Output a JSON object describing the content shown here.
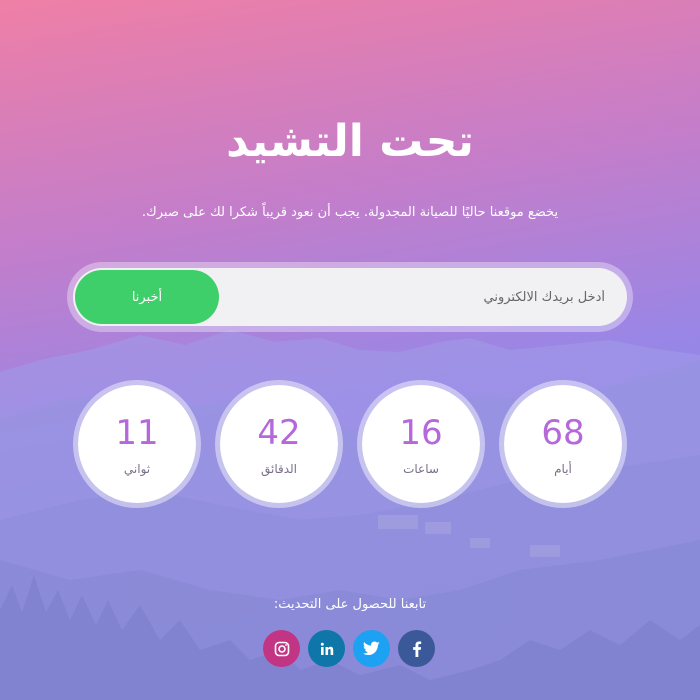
{
  "header": {
    "title": "تحت التشيد",
    "subtitle": "يخضع موقعنا حاليًا للصيانة المجدولة. يجب أن نعود قريباً شكرا لك على صبرك."
  },
  "subscribe": {
    "placeholder": "أدخل بريدك الالكتروني",
    "button_label": "أخبرنا"
  },
  "countdown": [
    {
      "value": "68",
      "label": "أيام"
    },
    {
      "value": "16",
      "label": "ساعات"
    },
    {
      "value": "42",
      "label": "الدقائق"
    },
    {
      "value": "11",
      "label": "ثواني"
    }
  ],
  "footer": {
    "follow_text": "تابعنا للحصول على التحديث:",
    "socials": [
      {
        "icon": "facebook-icon",
        "color": "#3b5998"
      },
      {
        "icon": "twitter-icon",
        "color": "#1da1f2"
      },
      {
        "icon": "linkedin-icon",
        "color": "#0e76a8"
      },
      {
        "icon": "instagram-icon",
        "color": "#c13584"
      }
    ]
  },
  "colors": {
    "accent_number": "#b468d9",
    "button_green": "#3fcf6a"
  }
}
